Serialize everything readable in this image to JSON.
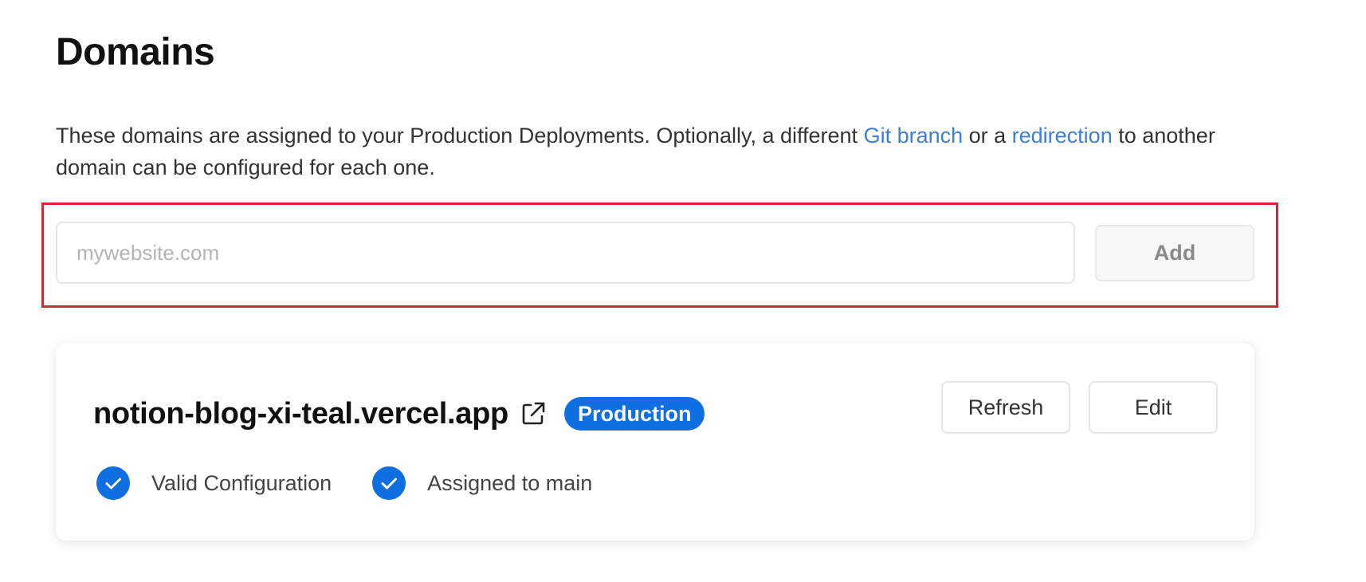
{
  "page": {
    "title": "Domains",
    "description": {
      "part1": "These domains are assigned to your Production Deployments. Optionally, a different ",
      "link_git_branch": "Git branch",
      "part2": " or a ",
      "link_redirection": "redirection",
      "part3": " to another domain can be configured for each one."
    }
  },
  "add_domain": {
    "placeholder": "mywebsite.com",
    "value": "",
    "add_label": "Add"
  },
  "domain_card": {
    "domain": "notion-blog-xi-teal.vercel.app",
    "badge": "Production",
    "refresh_label": "Refresh",
    "edit_label": "Edit",
    "statuses": [
      {
        "label": "Valid Configuration",
        "icon": "check-circle-icon"
      },
      {
        "label": "Assigned to main",
        "icon": "check-circle-icon"
      }
    ]
  },
  "colors": {
    "accent": "#0f6fe0",
    "link": "#3b7fd9",
    "highlight_border": "#d02a3a"
  }
}
